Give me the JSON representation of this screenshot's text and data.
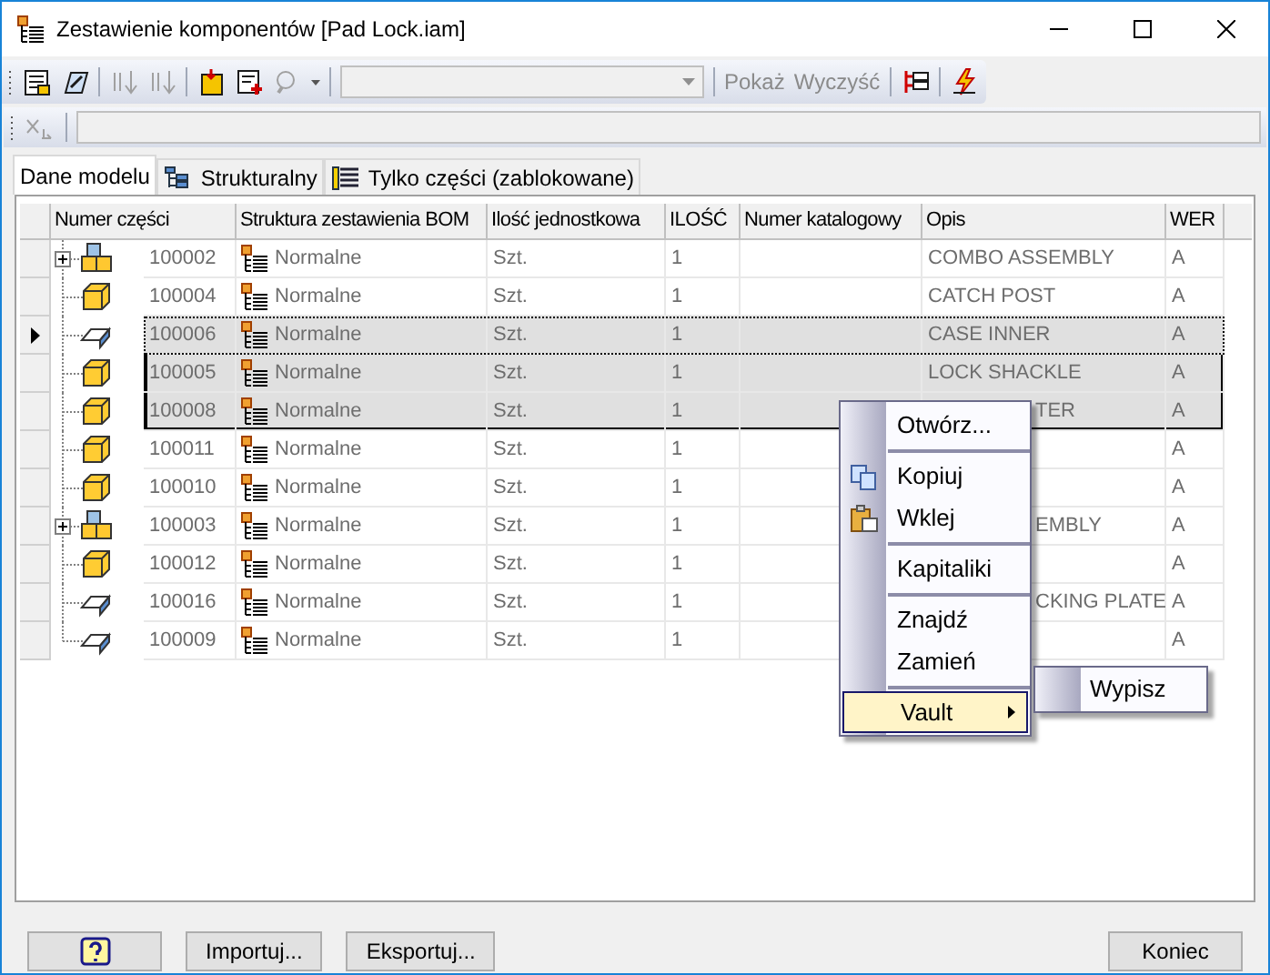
{
  "window": {
    "title": "Zestawienie komponentów [Pad Lock.iam]"
  },
  "toolbar": {
    "buttons": [
      {
        "kind": "bom",
        "disabled": false
      },
      {
        "kind": "pencil",
        "disabled": false
      },
      {
        "kind": "sort-up",
        "disabled": true
      },
      {
        "kind": "sort-down",
        "disabled": true
      },
      {
        "kind": "insert",
        "disabled": false
      },
      {
        "kind": "add",
        "disabled": false
      },
      {
        "kind": "lens",
        "disabled": true
      }
    ],
    "text_buttons": [
      {
        "label": "Pokaż",
        "disabled": true
      },
      {
        "label": "Wyczyść",
        "disabled": true
      }
    ],
    "buttons_after": [
      {
        "kind": "tree-export",
        "disabled": false
      },
      {
        "kind": "lightning",
        "disabled": false
      }
    ]
  },
  "tabs": [
    {
      "label": "Dane modelu",
      "kind": "plain",
      "selected": true
    },
    {
      "label": "Strukturalny",
      "kind": "tree",
      "selected": false
    },
    {
      "label": "Tylko części (zablokowane)",
      "kind": "list",
      "selected": false
    }
  ],
  "table": {
    "columns": [
      "Numer części",
      "Struktura zestawienia BOM",
      "Ilość jednostkowa",
      "ILOŚĆ",
      "Numer katalogowy",
      "Opis",
      "WER"
    ],
    "rows": [
      {
        "kind": "assembly",
        "expanded": false,
        "number": "100002",
        "structure": "Normalne",
        "unit": "Szt.",
        "qty": "1",
        "description": "COMBO ASSEMBLY",
        "revision": "A",
        "selected": false,
        "current": false
      },
      {
        "kind": "part",
        "number": "100004",
        "structure": "Normalne",
        "unit": "Szt.",
        "qty": "1",
        "description": "CATCH POST",
        "revision": "A",
        "selected": false,
        "current": false
      },
      {
        "kind": "sheet",
        "number": "100006",
        "structure": "Normalne",
        "unit": "Szt.",
        "qty": "1",
        "description": "CASE INNER",
        "revision": "A",
        "selected": true,
        "current": true
      },
      {
        "kind": "part",
        "number": "100005",
        "structure": "Normalne",
        "unit": "Szt.",
        "qty": "1",
        "description": "LOCK SHACKLE",
        "revision": "A",
        "selected": true,
        "current": false
      },
      {
        "kind": "part",
        "number": "100008",
        "structure": "Normalne",
        "unit": "Szt.",
        "qty": "1",
        "description": "TER",
        "cut": true,
        "revision": "A",
        "selected": true,
        "current": false
      },
      {
        "kind": "part",
        "number": "100011",
        "structure": "Normalne",
        "unit": "Szt.",
        "qty": "1",
        "revision": "A",
        "selected": false,
        "current": false
      },
      {
        "kind": "part",
        "number": "100010",
        "structure": "Normalne",
        "unit": "Szt.",
        "qty": "1",
        "revision": "A",
        "selected": false,
        "current": false
      },
      {
        "kind": "assembly",
        "expanded": false,
        "number": "100003",
        "structure": "Normalne",
        "unit": "Szt.",
        "qty": "1",
        "description": "EMBLY",
        "cut": true,
        "revision": "A",
        "selected": false,
        "current": false
      },
      {
        "kind": "part",
        "number": "100012",
        "structure": "Normalne",
        "unit": "Szt.",
        "qty": "1",
        "revision": "A",
        "selected": false,
        "current": false
      },
      {
        "kind": "sheet",
        "number": "100016",
        "structure": "Normalne",
        "unit": "Szt.",
        "qty": "1",
        "description": "CKING PLATE",
        "cut": true,
        "revision": "A",
        "selected": false,
        "current": false
      },
      {
        "kind": "sheet",
        "number": "100009",
        "structure": "Normalne",
        "unit": "Szt.",
        "qty": "1",
        "revision": "A",
        "selected": false,
        "current": false
      }
    ]
  },
  "context_menu": {
    "items": [
      {
        "kind": "item",
        "label": "Otwórz...",
        "selected": false
      },
      {
        "kind": "separator"
      },
      {
        "kind": "copy",
        "label": "Kopiuj",
        "selected": false
      },
      {
        "kind": "paste",
        "label": "Wklej",
        "selected": false
      },
      {
        "kind": "separator"
      },
      {
        "kind": "item",
        "label": "Kapitaliki",
        "selected": false
      },
      {
        "kind": "separator"
      },
      {
        "kind": "item",
        "label": "Znajdź",
        "selected": false
      },
      {
        "kind": "item",
        "label": "Zamień",
        "selected": false
      },
      {
        "kind": "separator"
      },
      {
        "kind": "submenu",
        "label": "Vault",
        "selected": true
      }
    ],
    "submenu": {
      "items": [
        {
          "label": "Wypisz"
        }
      ]
    }
  },
  "footer": {
    "buttons": [
      {
        "kind": "help"
      },
      {
        "kind": "text",
        "label": "Importuj..."
      },
      {
        "kind": "text",
        "label": "Eksportuj..."
      },
      {
        "kind": "text",
        "label": "Koniec"
      }
    ]
  }
}
